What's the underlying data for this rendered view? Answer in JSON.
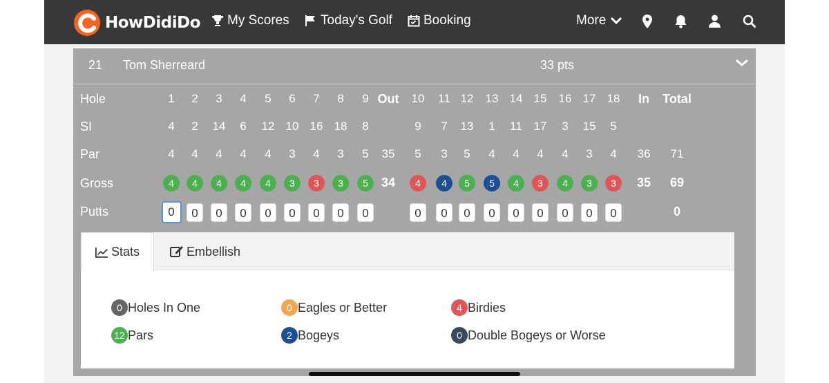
{
  "nav": {
    "logo_text": "HowDidiDo",
    "items": [
      {
        "label": "My Scores",
        "icon": "trophy-icon"
      },
      {
        "label": "Today's Golf",
        "icon": "flag-icon"
      },
      {
        "label": "Booking",
        "icon": "calendar-icon"
      },
      {
        "label": "More",
        "icon": "chevron-down-icon"
      }
    ],
    "icons": [
      "location-pin-icon",
      "bell-icon",
      "user-icon",
      "search-icon"
    ]
  },
  "player": {
    "position": "21",
    "name": "Tom Sherreard",
    "points": "33 pts"
  },
  "scorecard": {
    "labels": {
      "hole": "Hole",
      "si": "SI",
      "par": "Par",
      "gross": "Gross",
      "putts": "Putts"
    },
    "holes": [
      "1",
      "2",
      "3",
      "4",
      "5",
      "6",
      "7",
      "8",
      "9",
      "Out",
      "10",
      "11",
      "12",
      "13",
      "14",
      "15",
      "16",
      "17",
      "18",
      "In",
      "Total"
    ],
    "si": [
      "4",
      "2",
      "14",
      "6",
      "12",
      "10",
      "16",
      "18",
      "8",
      "",
      "9",
      "7",
      "13",
      "1",
      "11",
      "17",
      "3",
      "15",
      "5",
      "",
      ""
    ],
    "par": [
      "4",
      "4",
      "4",
      "4",
      "4",
      "3",
      "4",
      "3",
      "5",
      "35",
      "5",
      "3",
      "5",
      "4",
      "4",
      "4",
      "4",
      "3",
      "4",
      "36",
      "71"
    ],
    "gross": [
      "4",
      "4",
      "4",
      "4",
      "4",
      "3",
      "3",
      "3",
      "5",
      "34",
      "4",
      "4",
      "5",
      "5",
      "4",
      "3",
      "4",
      "3",
      "3",
      "35",
      "69"
    ],
    "gross_colors": [
      "green",
      "green",
      "green",
      "green",
      "green",
      "green",
      "red",
      "green",
      "green",
      "",
      "red",
      "blue",
      "green",
      "blue",
      "green",
      "red",
      "green",
      "green",
      "red",
      "",
      ""
    ],
    "putts": [
      "0",
      "0",
      "0",
      "0",
      "0",
      "0",
      "0",
      "0",
      "0",
      "",
      "0",
      "0",
      "0",
      "0",
      "0",
      "0",
      "0",
      "0",
      "0",
      "",
      "0"
    ]
  },
  "tabs": [
    {
      "label": "Stats",
      "icon": "chart-line-icon"
    },
    {
      "label": "Embellish",
      "icon": "edit-icon"
    }
  ],
  "stats": [
    {
      "count": "0",
      "label": "Holes In One",
      "color": "#666666"
    },
    {
      "count": "0",
      "label": "Eagles or Better",
      "color": "#f0a850"
    },
    {
      "count": "4",
      "label": "Birdies",
      "color": "#e05555"
    },
    {
      "count": "12",
      "label": "Pars",
      "color": "#4caf50"
    },
    {
      "count": "2",
      "label": "Bogeys",
      "color": "#1d4e96"
    },
    {
      "count": "0",
      "label": "Double Bogeys or Worse",
      "color": "#3a4a5c"
    }
  ],
  "colors": {
    "navbar": "#383838",
    "card": "#a6a6a6",
    "accent": "#f26522"
  }
}
